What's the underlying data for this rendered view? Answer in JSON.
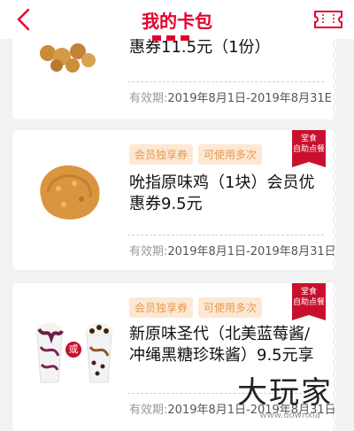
{
  "header": {
    "title": "我的卡包",
    "back_icon": "back-chevron-icon",
    "ticket_icon": "ticket-icon"
  },
  "coupons": [
    {
      "name_partial": "惠券11.5元（1份）",
      "validity_label": "有效期:",
      "validity_range": "2019年8月1日-2019年8月31E"
    },
    {
      "tags": [
        "会员独享券",
        "可使用多次"
      ],
      "badge_line1": "堂食",
      "badge_line2": "自助点餐",
      "name": "吮指原味鸡（1块）会员优惠券9.5元",
      "validity_label": "有效期:",
      "validity_range": "2019年8月1日-2019年8月31日"
    },
    {
      "tags": [
        "会员独享券",
        "可使用多次"
      ],
      "badge_line1": "堂食",
      "badge_line2": "自助点餐",
      "name": "新原味圣代（北美蓝莓酱/冲绳黑糖珍珠酱）9.5元享",
      "or_label": "或",
      "validity_label": "有效期:",
      "validity_range": "2019年8月1日-2019年8月31日"
    }
  ],
  "watermark": {
    "text": "大玩家",
    "url": "www.downxia"
  },
  "colors": {
    "brand_red": "#e4002b",
    "tag_text": "#e39b52",
    "tag_bg": "#fde8d4"
  }
}
